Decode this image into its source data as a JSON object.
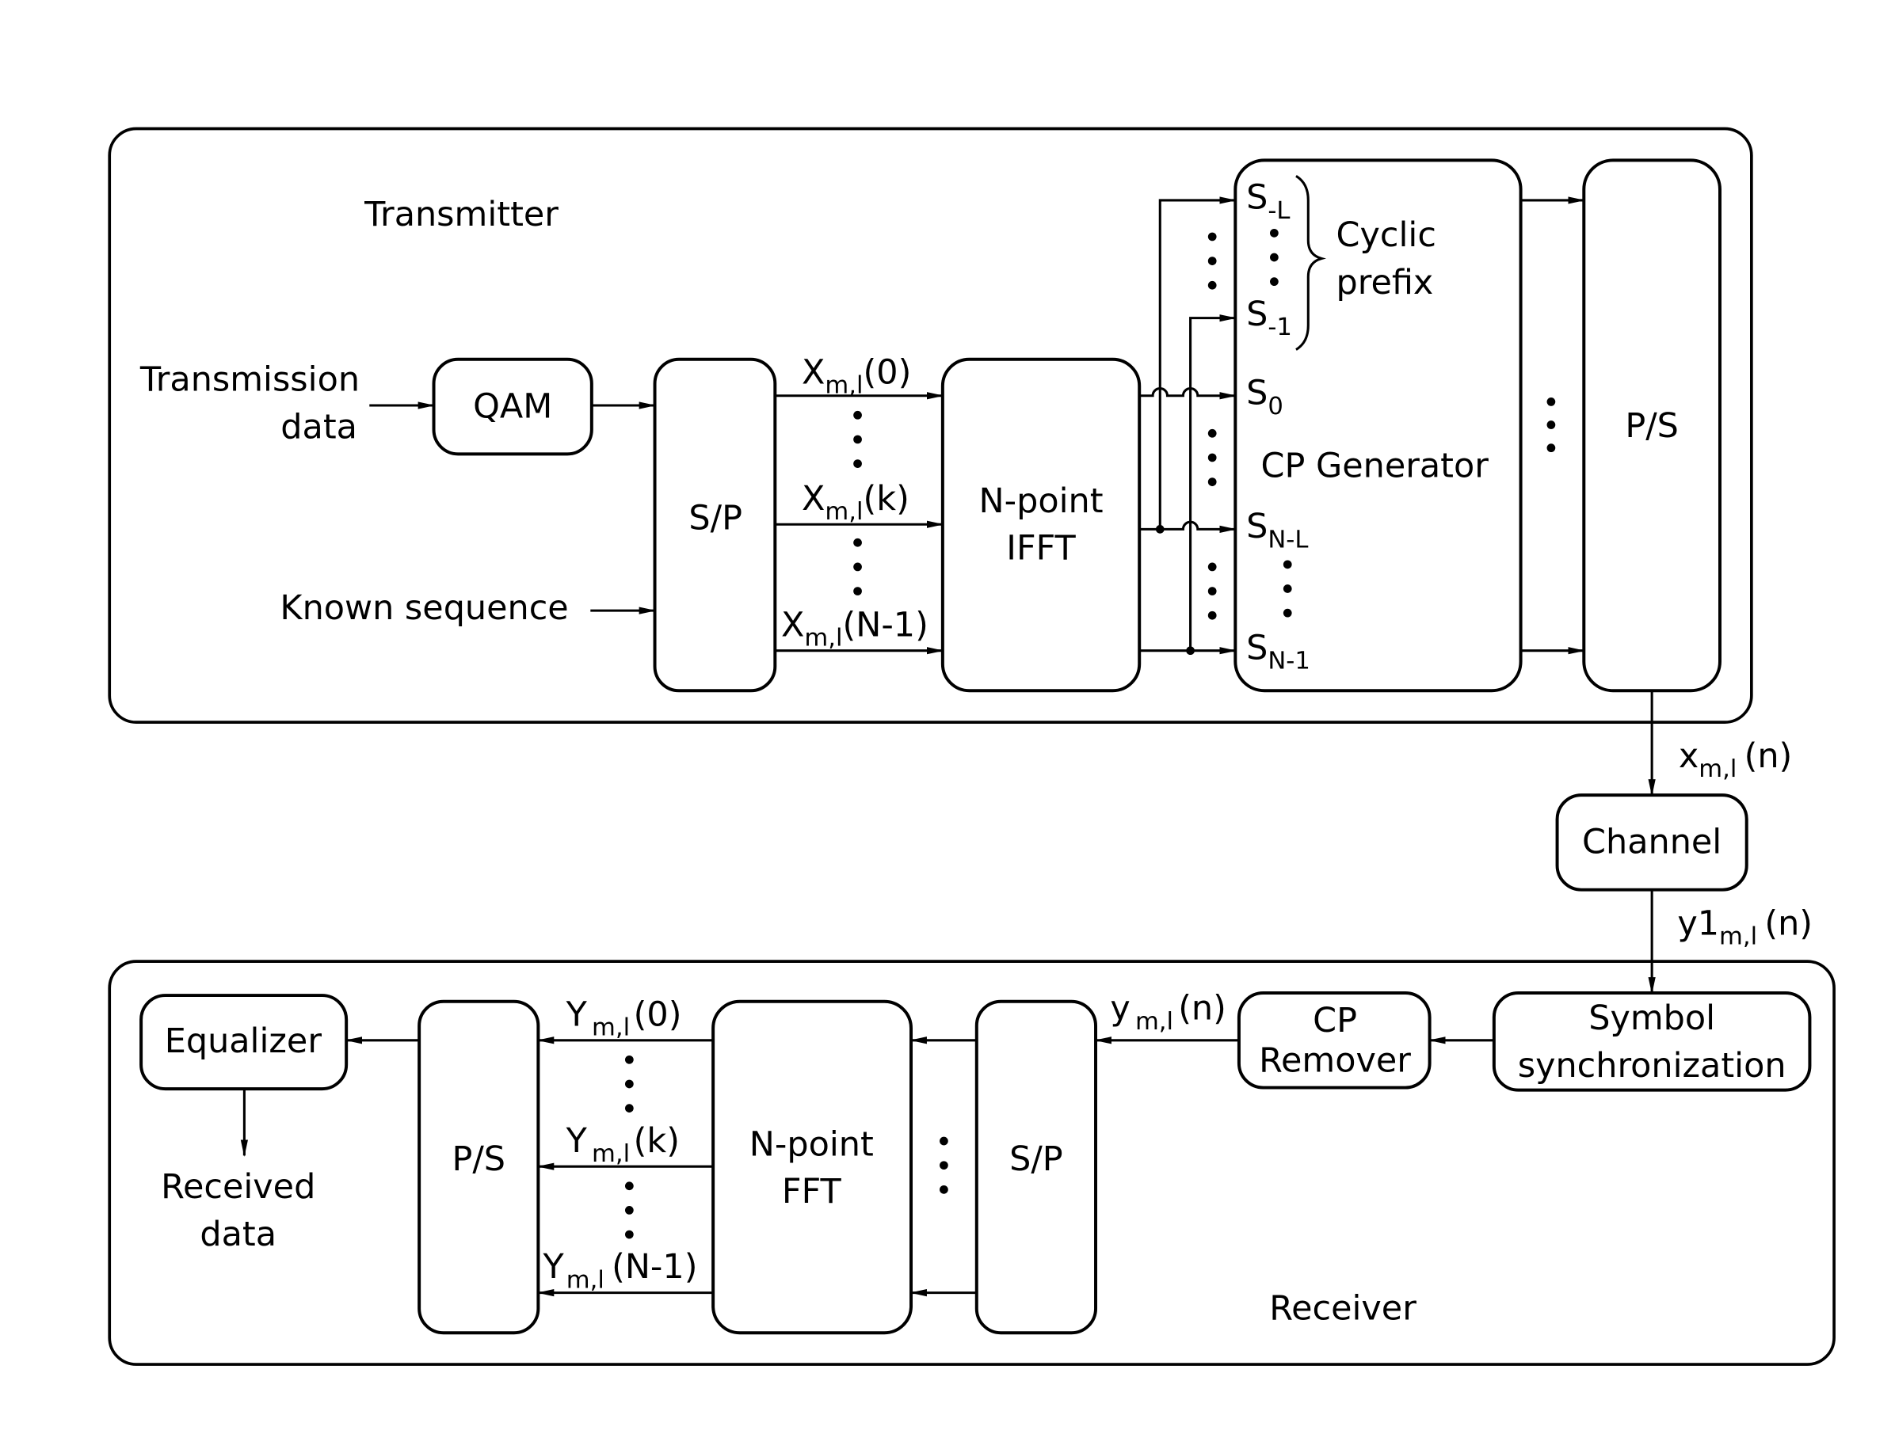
{
  "transmitter": {
    "title": "Transmitter",
    "inputs": {
      "transmission_data_line1": "Transmission",
      "transmission_data_line2": "data",
      "known_sequence": "Known sequence"
    },
    "qam": "QAM",
    "sp": "S/P",
    "ifft_line1": "N-point",
    "ifft_line2": "IFFT",
    "x_signals": [
      {
        "base": "X",
        "sub": "m,l",
        "arg": "(0)"
      },
      {
        "base": "X",
        "sub": "m,l",
        "arg": "(k)"
      },
      {
        "base": "X",
        "sub": "m,l",
        "arg": "(N-1)"
      }
    ],
    "cp_generator": {
      "label": "CP Generator",
      "samples": [
        {
          "base": "S",
          "sub": "-L"
        },
        {
          "base": "S",
          "sub": "-1"
        },
        {
          "base": "S",
          "sub": "0"
        },
        {
          "base": "S",
          "sub": "N-L"
        },
        {
          "base": "S",
          "sub": "N-1"
        }
      ],
      "brace_line1": "Cyclic",
      "brace_line2": "prefix"
    },
    "ps": "P/S",
    "output_signal": {
      "base": "x",
      "sub": "m,l",
      "arg": "(n)"
    }
  },
  "channel": {
    "label": "Channel",
    "output_signal": {
      "base": "y1",
      "sub": "m,l",
      "arg": "(n)"
    }
  },
  "receiver": {
    "title": "Receiver",
    "symbol_sync_line1": "Symbol",
    "symbol_sync_line2": "synchronization",
    "cp_remover_line1": "CP",
    "cp_remover_line2": "Remover",
    "y_signal": {
      "base": "y",
      "sub": "m,l",
      "arg": "(n)"
    },
    "sp": "S/P",
    "fft_line1": "N-point",
    "fft_line2": "FFT",
    "Y_signals": [
      {
        "base": "Y",
        "sub": "m,l",
        "arg": "(0)"
      },
      {
        "base": "Y",
        "sub": "m,l",
        "arg": "(k)"
      },
      {
        "base": "Y",
        "sub": "m,l",
        "arg": "(N-1)"
      }
    ],
    "ps": "P/S",
    "equalizer": "Equalizer",
    "received_line1": "Received",
    "received_line2": "data"
  }
}
